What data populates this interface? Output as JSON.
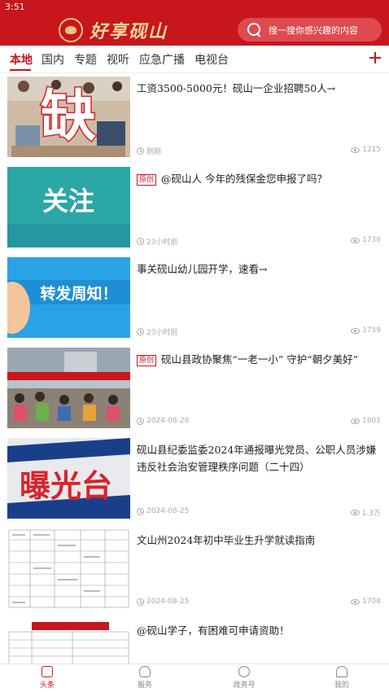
{
  "status_bar": {
    "time": "3:51"
  },
  "header": {
    "logo_text": "好享砚山",
    "search_placeholder": "搜一搜你感兴趣的内容"
  },
  "tabs": [
    "本地",
    "国内",
    "专题",
    "视听",
    "应急广播",
    "电视台"
  ],
  "active_tab": "本地",
  "articles": [
    {
      "title": "工资3500-5000元！砚山一企业招聘50人→",
      "original": false,
      "time": "刚刚",
      "views": "1215",
      "thumb_text": "缺"
    },
    {
      "title": "@砚山人 今年的残保金您申报了吗？",
      "original": true,
      "badge": "原创",
      "time": "23小时前",
      "views": "1730",
      "thumb_text": "关注"
    },
    {
      "title": "事关砚山幼儿园开学，速看→",
      "original": false,
      "time": "23小时前",
      "views": "1759",
      "thumb_text": "转发周知！"
    },
    {
      "title": "砚山县政协聚焦“一老一小” 守护“朝夕美好”",
      "original": true,
      "badge": "原创",
      "time": "2024-08-26",
      "views": "1801",
      "thumb_text": ""
    },
    {
      "title": "砚山县纪委监委2024年通报曝光党员、公职人员涉嫌违反社会治安管理秩序问题（二十四）",
      "original": false,
      "time": "2024-08-25",
      "views": "1.3万",
      "thumb_text": "曝光台"
    },
    {
      "title": "文山州2024年初中毕业生升学就读指南",
      "original": false,
      "time": "2024-08-25",
      "views": "1708",
      "thumb_text": ""
    },
    {
      "title": "@砚山学子，有困难可申请资助！",
      "original": false,
      "time": "",
      "views": "",
      "thumb_text": ""
    }
  ],
  "bottom_nav": [
    {
      "label": "头条",
      "icon": "document-icon",
      "active": true
    },
    {
      "label": "服务",
      "icon": "heart-hand-icon",
      "active": false
    },
    {
      "label": "政务号",
      "icon": "face-icon",
      "active": false
    },
    {
      "label": "我的",
      "icon": "person-icon",
      "active": false
    }
  ],
  "colors": {
    "brand_red": "#c8161d",
    "logo_gold": "#f5d49a"
  }
}
